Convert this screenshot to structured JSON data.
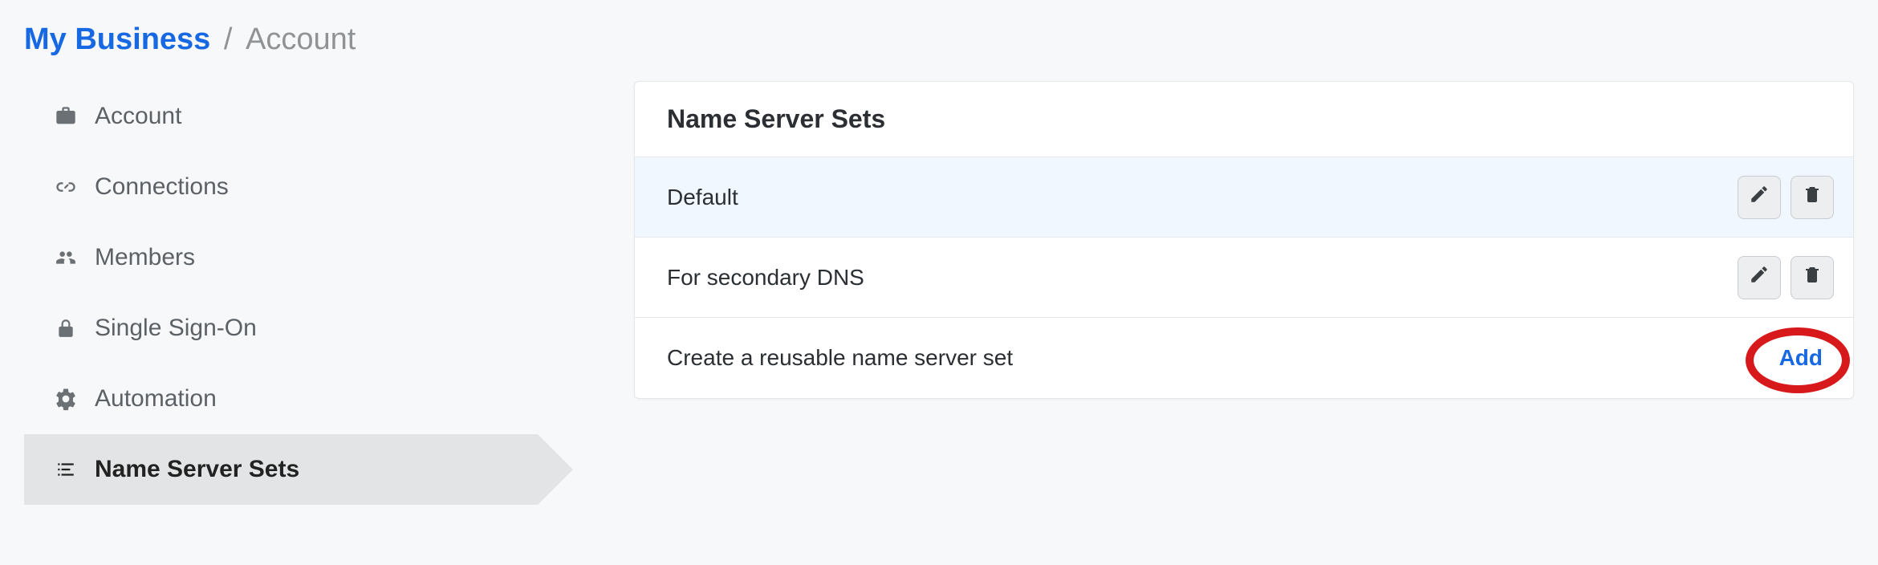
{
  "breadcrumb": {
    "root": "My Business",
    "sep": "/",
    "leaf": "Account"
  },
  "sidebar": {
    "items": [
      {
        "label": "Account"
      },
      {
        "label": "Connections"
      },
      {
        "label": "Members"
      },
      {
        "label": "Single Sign-On"
      },
      {
        "label": "Automation"
      },
      {
        "label": "Name Server Sets"
      }
    ]
  },
  "card": {
    "title": "Name Server Sets",
    "rows": [
      {
        "label": "Default"
      },
      {
        "label": "For secondary DNS"
      }
    ],
    "footer": {
      "text": "Create a reusable name server set",
      "action": "Add"
    }
  }
}
